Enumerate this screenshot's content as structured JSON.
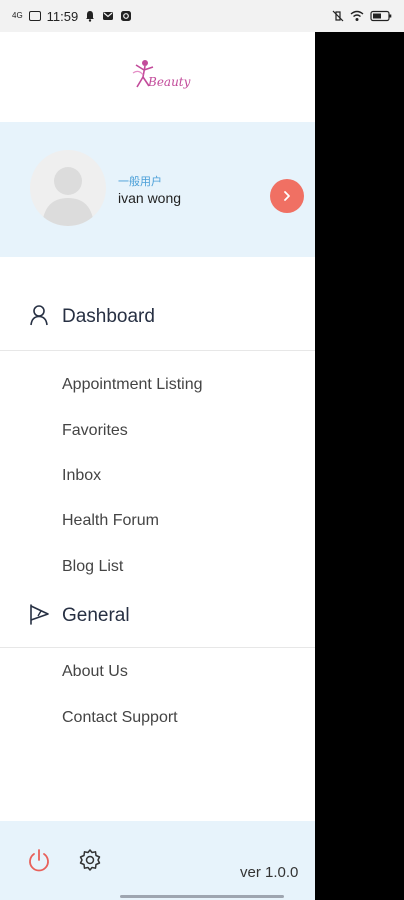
{
  "status_bar": {
    "network": "4G",
    "time": "11:59"
  },
  "logo": {
    "text": "Beauty"
  },
  "profile": {
    "role": "一般用户",
    "name": "ivan wong"
  },
  "sections": {
    "dashboard": {
      "label": "Dashboard",
      "items": [
        "Appointment Listing",
        "Favorites",
        "Inbox",
        "Health Forum",
        "Blog List"
      ]
    },
    "general": {
      "label": "General",
      "items": [
        "About Us",
        "Contact Support"
      ]
    }
  },
  "footer": {
    "version": "ver 1.0.0"
  },
  "colors": {
    "accent_blue": "#4a9fd8",
    "profile_bg": "#e7f3fb",
    "go_button": "#f07063",
    "power_icon": "#e8605a"
  },
  "icons": {
    "dashboard": "person-icon",
    "general": "flag-icon",
    "power": "power-icon",
    "settings": "gear-icon",
    "profile_go": "chevron-right-icon"
  }
}
